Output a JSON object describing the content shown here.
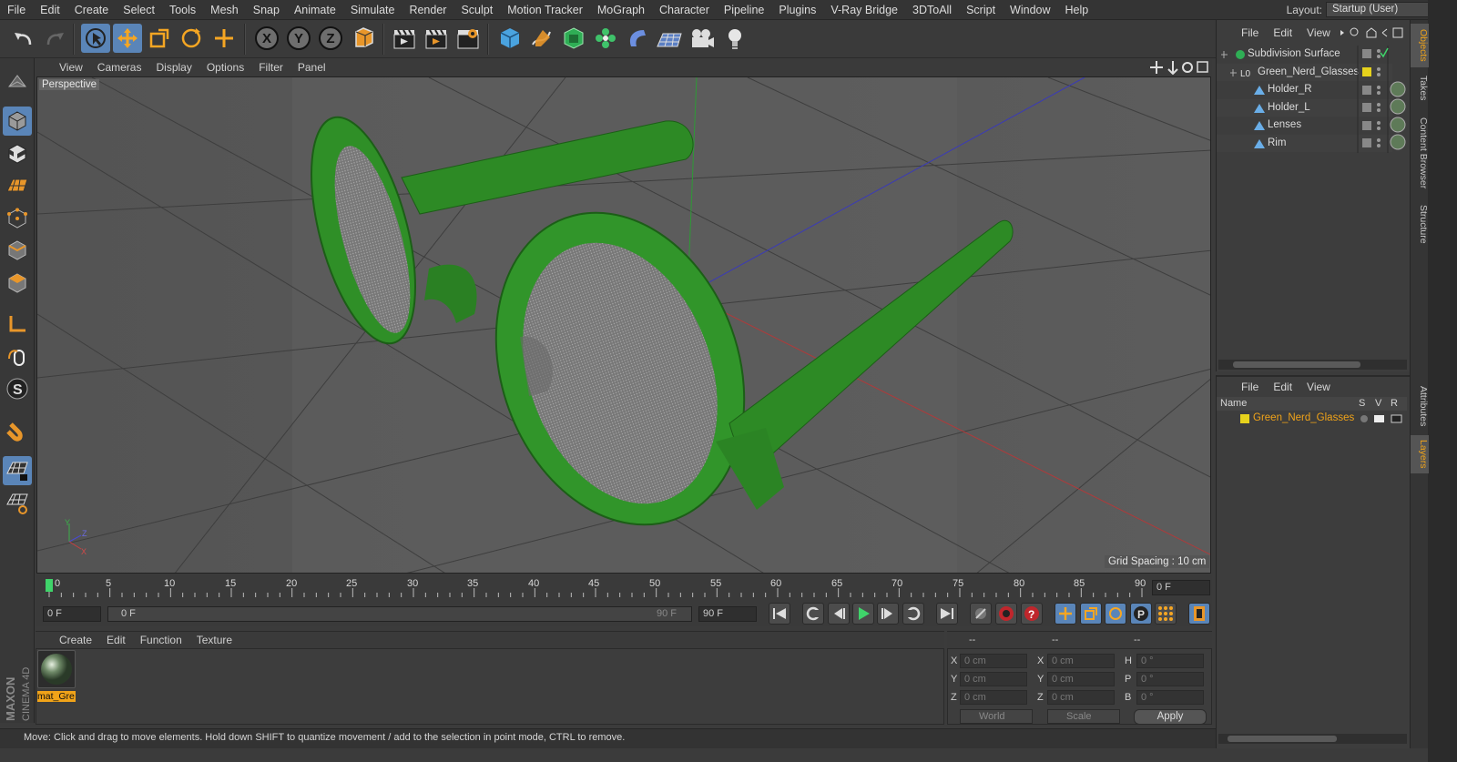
{
  "menubar": {
    "items": [
      "File",
      "Edit",
      "Create",
      "Select",
      "Tools",
      "Mesh",
      "Snap",
      "Animate",
      "Simulate",
      "Render",
      "Sculpt",
      "Motion Tracker",
      "MoGraph",
      "Character",
      "Pipeline",
      "Plugins",
      "V-Ray Bridge",
      "3DToAll",
      "Script",
      "Window",
      "Help"
    ],
    "layout_label": "Layout:",
    "layout_value": "Startup (User)"
  },
  "viewport": {
    "menu": [
      "View",
      "Cameras",
      "Display",
      "Options",
      "Filter",
      "Panel"
    ],
    "camera_label": "Perspective",
    "grid_spacing": "Grid Spacing : 10 cm",
    "axis_labels": {
      "y": "Y",
      "z": "Z",
      "x": "X"
    }
  },
  "timeline": {
    "ticks": [
      "0",
      "5",
      "10",
      "15",
      "20",
      "25",
      "30",
      "35",
      "40",
      "45",
      "50",
      "55",
      "60",
      "65",
      "70",
      "75",
      "80",
      "85",
      "90"
    ],
    "current_frame_right": "0 F",
    "start_field": "0 F",
    "range_start": "0 F",
    "range_end": "90 F",
    "end_field": "90 F"
  },
  "material_manager": {
    "menu": [
      "Create",
      "Edit",
      "Function",
      "Texture"
    ],
    "material_name": "mat_Gre"
  },
  "coordinates": {
    "header_left": "--",
    "header_mid": "--",
    "header_right": "--",
    "rows": [
      {
        "l1": "X",
        "v1": "0 cm",
        "l2": "X",
        "v2": "0 cm",
        "l3": "H",
        "v3": "0 °"
      },
      {
        "l1": "Y",
        "v1": "0 cm",
        "l2": "Y",
        "v2": "0 cm",
        "l3": "P",
        "v3": "0 °"
      },
      {
        "l1": "Z",
        "v1": "0 cm",
        "l2": "Z",
        "v2": "0 cm",
        "l3": "B",
        "v3": "0 °"
      }
    ],
    "mode_select": "World",
    "size_select": "Scale",
    "apply": "Apply"
  },
  "status": "Move: Click and drag to move elements. Hold down SHIFT to quantize movement / add to the selection in point mode, CTRL to remove.",
  "object_manager": {
    "menu": [
      "File",
      "Edit",
      "View"
    ],
    "objects": [
      {
        "name": "Subdivision Surface"
      },
      {
        "name": "Green_Nerd_Glasses"
      },
      {
        "name": "Holder_R"
      },
      {
        "name": "Holder_L"
      },
      {
        "name": "Lenses"
      },
      {
        "name": "Rim"
      }
    ]
  },
  "layer_manager": {
    "menu": [
      "File",
      "Edit",
      "View"
    ],
    "columns": {
      "name": "Name",
      "s": "S",
      "v": "V",
      "r": "R"
    },
    "layer_name": "Green_Nerd_Glasses"
  },
  "side_tabs": [
    "Objects",
    "Takes",
    "Content Browser",
    "Structure",
    "Attributes",
    "Layers"
  ],
  "branding": {
    "maxon": "MAXON",
    "product": "CINEMA 4D"
  },
  "colors": {
    "accent_blue": "#5a85b8",
    "layer_orange": "#f0a319",
    "model_green": "#2f8a26",
    "layer_yellow": "#e6d21c"
  }
}
